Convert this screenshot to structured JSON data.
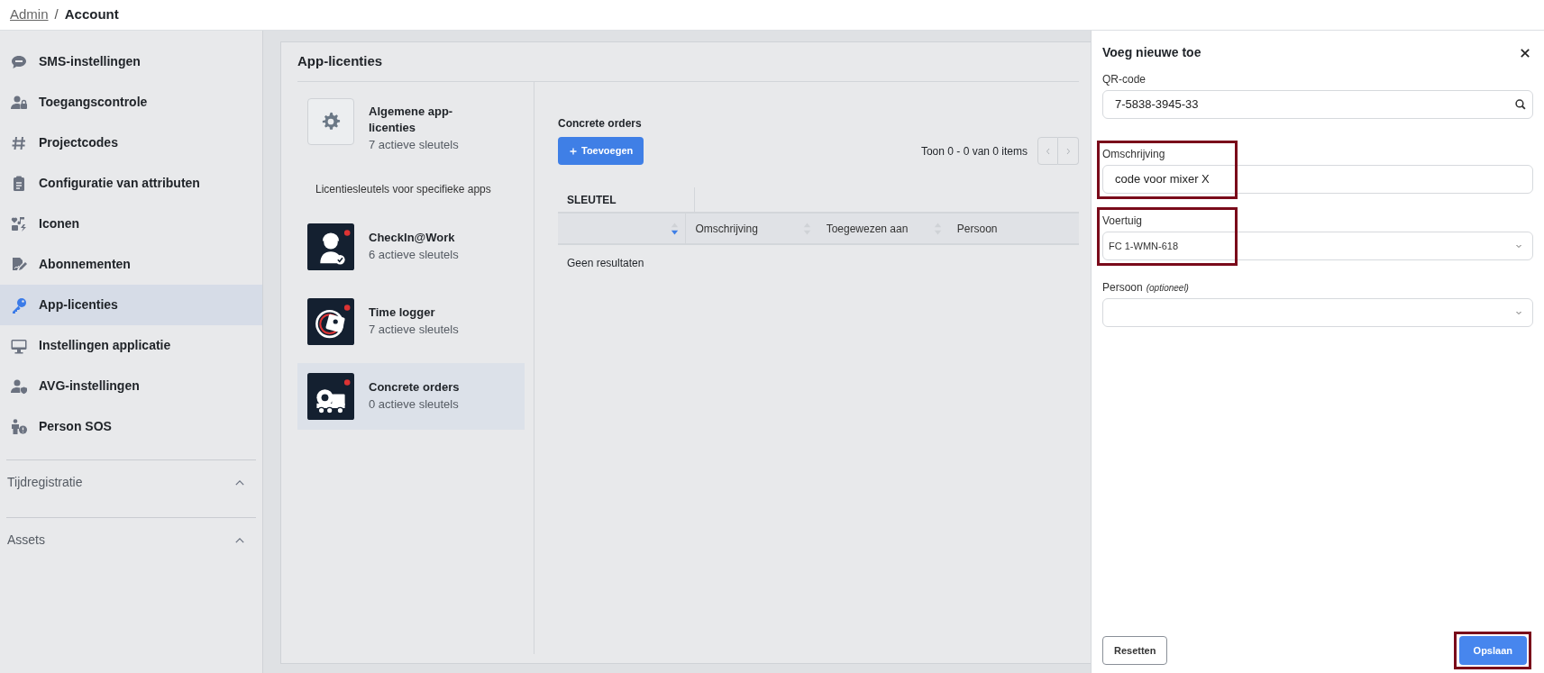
{
  "breadcrumb": {
    "separator": "/",
    "items": [
      {
        "label": "Admin",
        "link": true
      },
      {
        "label": "Account",
        "link": false
      }
    ]
  },
  "sidebar": {
    "items": [
      {
        "label": "SMS-instellingen",
        "selected": false
      },
      {
        "label": "Toegangscontrole",
        "selected": false
      },
      {
        "label": "Projectcodes",
        "selected": false
      },
      {
        "label": "Configuratie van attributen",
        "selected": false
      },
      {
        "label": "Iconen",
        "selected": false
      },
      {
        "label": "Abonnementen",
        "selected": false
      },
      {
        "label": "App-licenties",
        "selected": true
      },
      {
        "label": "Instellingen applicatie",
        "selected": false
      },
      {
        "label": "AVG-instellingen",
        "selected": false
      },
      {
        "label": "Person SOS",
        "selected": false
      }
    ],
    "sections": [
      {
        "label": "Tijdregistratie"
      },
      {
        "label": "Assets"
      }
    ]
  },
  "panel": {
    "title": "App-licenties",
    "general": {
      "title": "Algemene app-licenties",
      "subtitle": "7 actieve sleutels"
    },
    "section_label": "Licentiesleutels voor specifieke apps",
    "apps": [
      {
        "title": "CheckIn@Work",
        "subtitle": "6 actieve sleutels",
        "selected": false
      },
      {
        "title": "Time logger",
        "subtitle": "7 actieve sleutels",
        "selected": false
      },
      {
        "title": "Concrete orders",
        "subtitle": "0 actieve sleutels",
        "selected": true
      }
    ],
    "detail": {
      "title": "Concrete orders",
      "add_button": "Toevoegen",
      "pagination": "Toon 0 - 0 van 0 items",
      "table": {
        "group_header": "SLEUTEL",
        "columns": [
          {
            "sorted": true
          },
          {
            "label": "Omschrijving",
            "sorted": false
          },
          {
            "label": "Toegewezen aan",
            "sorted": false
          },
          {
            "label": "Persoon"
          }
        ],
        "empty": "Geen resultaten"
      }
    }
  },
  "drawer": {
    "title": "Voeg nieuwe toe",
    "fields": [
      {
        "kind": "search",
        "label": "QR-code",
        "value": "7-5838-3945-33",
        "highlighted": false
      },
      {
        "kind": "text",
        "label": "Omschrijving",
        "value": "code voor mixer X",
        "highlighted": true
      },
      {
        "kind": "select",
        "label": "Voertuig",
        "value": "FC 1-WMN-618",
        "highlighted": true
      },
      {
        "kind": "select",
        "label": "Persoon",
        "hint": "(optioneel)",
        "highlighted": false
      }
    ],
    "buttons": [
      {
        "label": "Resetten",
        "kind": "secondary",
        "highlighted": false
      },
      {
        "label": "Opslaan",
        "kind": "primary",
        "highlighted": true
      }
    ]
  }
}
